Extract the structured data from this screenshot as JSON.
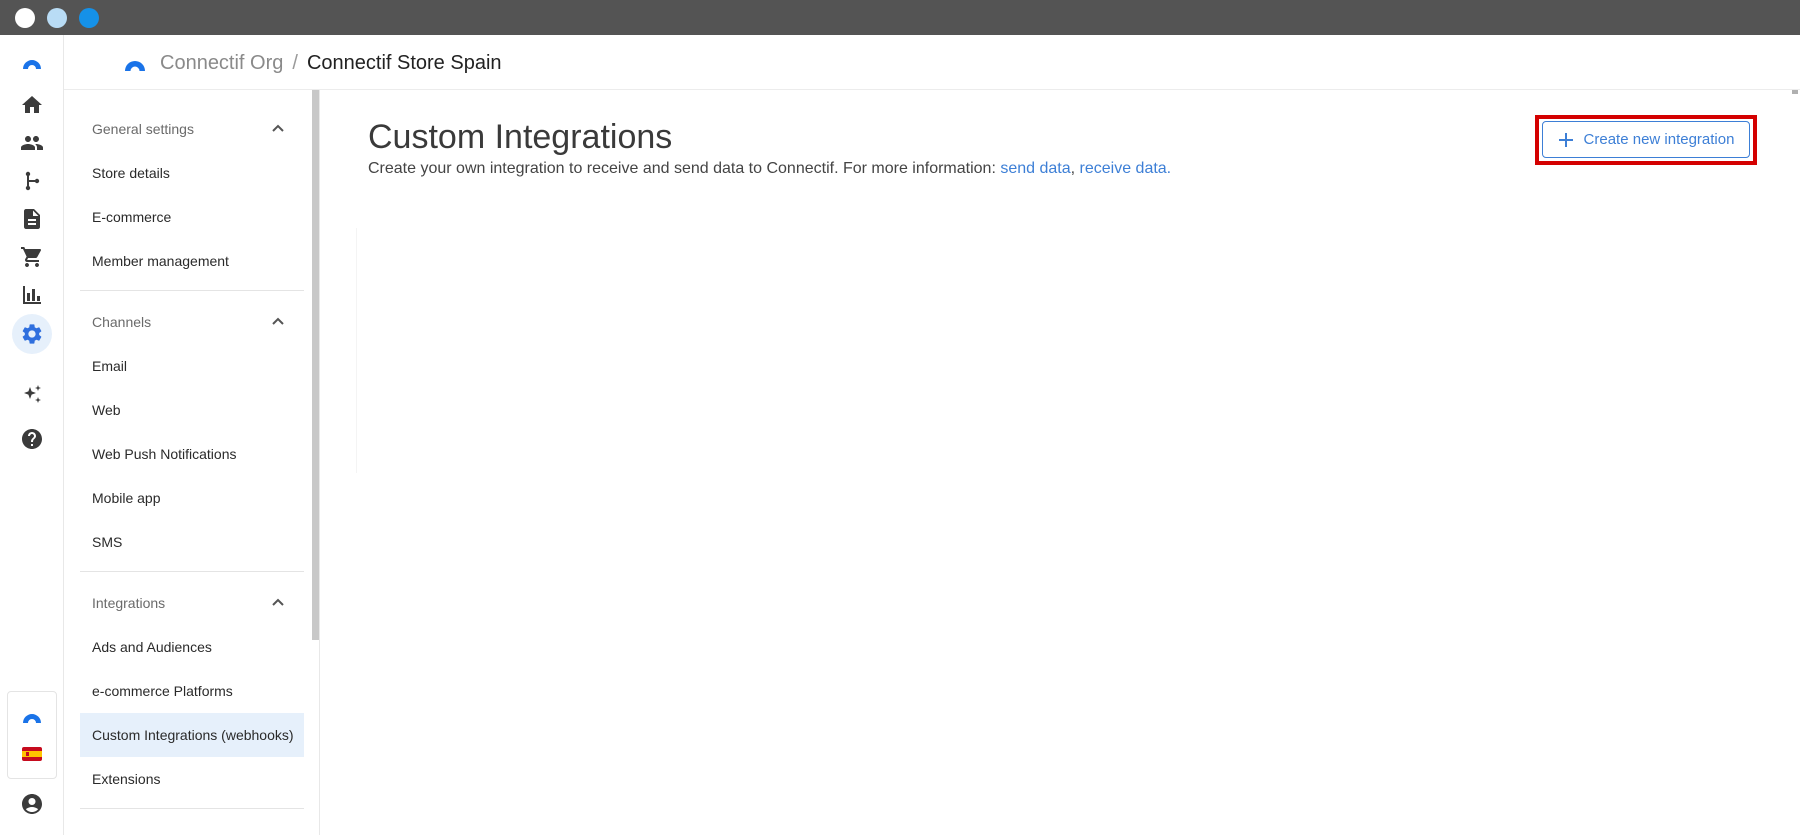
{
  "header": {
    "org_name": "Connectif Org",
    "separator": "/",
    "store_name": "Connectif Store Spain"
  },
  "rail": {
    "items": [
      {
        "icon": "home-icon"
      },
      {
        "icon": "people-icon"
      },
      {
        "icon": "workflow-icon"
      },
      {
        "icon": "document-icon"
      },
      {
        "icon": "cart-icon"
      },
      {
        "icon": "bar-chart-icon"
      },
      {
        "icon": "settings-icon",
        "active": true
      },
      {
        "icon": "sparkle-icon"
      },
      {
        "icon": "help-icon"
      }
    ],
    "bottom": [
      "connectif-logo-icon",
      "spain-flag-icon",
      "account-icon"
    ]
  },
  "sidebar": {
    "sections": [
      {
        "title": "General settings",
        "items": [
          "Store details",
          "E-commerce",
          "Member management"
        ]
      },
      {
        "title": "Channels",
        "items": [
          "Email",
          "Web",
          "Web Push Notifications",
          "Mobile app",
          "SMS"
        ]
      },
      {
        "title": "Integrations",
        "items": [
          "Ads and Audiences",
          "e-commerce Platforms",
          "Custom Integrations (webhooks)",
          "Extensions"
        ]
      }
    ],
    "active_item": "Custom Integrations (webhooks)"
  },
  "main": {
    "title": "Custom Integrations",
    "description_prefix": "Create your own integration to receive and send data to Connectif. For more information: ",
    "link_send": "send data",
    "link_separator": ", ",
    "link_receive": "receive data.",
    "create_button_label": "Create new integration"
  },
  "colors": {
    "accent": "#3d7fd6",
    "active_bg": "#e6f0fb",
    "highlight": "#d40000",
    "titlebar": "#545454"
  }
}
